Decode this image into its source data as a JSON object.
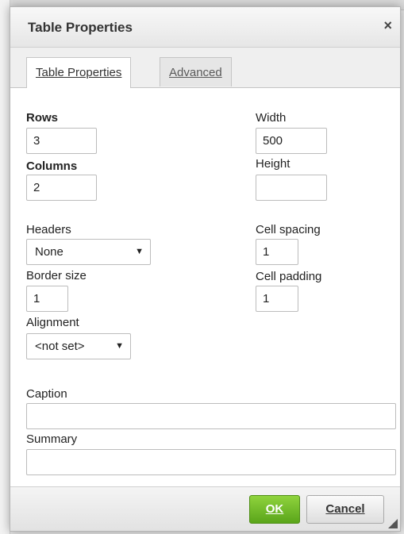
{
  "dialog": {
    "title": "Table Properties",
    "close_glyph": "×"
  },
  "tabs": [
    {
      "label": "Table Properties"
    },
    {
      "label": "Advanced"
    }
  ],
  "fields": {
    "rows": {
      "label": "Rows",
      "value": "3"
    },
    "columns": {
      "label": "Columns",
      "value": "2"
    },
    "width": {
      "label": "Width",
      "value": "500"
    },
    "height": {
      "label": "Height",
      "value": ""
    },
    "headers": {
      "label": "Headers",
      "value": "None"
    },
    "cell_spacing": {
      "label": "Cell spacing",
      "value": "1"
    },
    "border_size": {
      "label": "Border size",
      "value": "1"
    },
    "cell_padding": {
      "label": "Cell padding",
      "value": "1"
    },
    "alignment": {
      "label": "Alignment",
      "value": "<not set>"
    },
    "caption": {
      "label": "Caption",
      "value": ""
    },
    "summary": {
      "label": "Summary",
      "value": ""
    }
  },
  "dropdown_arrow": "▼",
  "buttons": {
    "ok": "OK",
    "cancel": "Cancel"
  },
  "colors": {
    "ok_button": "#6cbb27",
    "titlebar": "#eeeeee"
  }
}
